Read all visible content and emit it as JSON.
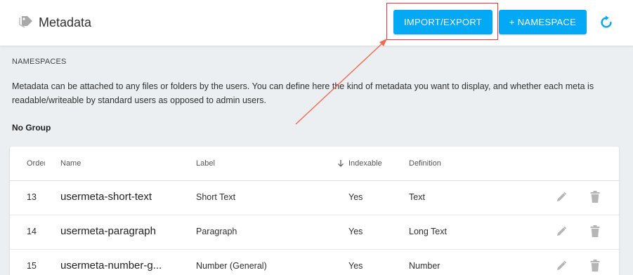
{
  "header": {
    "title": "Metadata",
    "import_export_label": "IMPORT/EXPORT",
    "namespace_label": "+ NAMESPACE"
  },
  "content": {
    "section_title": "NAMESPACES",
    "description": "Metadata can be attached to any files or folders by the users. You can define here the kind of metadata you want to display, and whether each meta is readable/writeable by standard users as opposed to admin users.",
    "group_title": "No Group"
  },
  "table": {
    "columns": {
      "order": "Order",
      "name": "Name",
      "label": "Label",
      "indexable": "Indexable",
      "definition": "Definition"
    },
    "rows": [
      {
        "order": "13",
        "name": "usermeta-short-text",
        "label": "Short Text",
        "indexable": "Yes",
        "definition": "Text"
      },
      {
        "order": "14",
        "name": "usermeta-paragraph",
        "label": "Paragraph",
        "indexable": "Yes",
        "definition": "Long Text"
      },
      {
        "order": "15",
        "name": "usermeta-number-g...",
        "label": "Number (General)",
        "indexable": "Yes",
        "definition": "Number"
      }
    ]
  },
  "icons": {
    "tag": "tag-icon",
    "refresh": "refresh-icon",
    "sort": "arrow-down-icon",
    "edit": "pencil-icon",
    "delete": "trash-icon"
  },
  "colors": {
    "accent": "#03a9f4",
    "annotation": "#e53935",
    "background": "#eceff1"
  }
}
